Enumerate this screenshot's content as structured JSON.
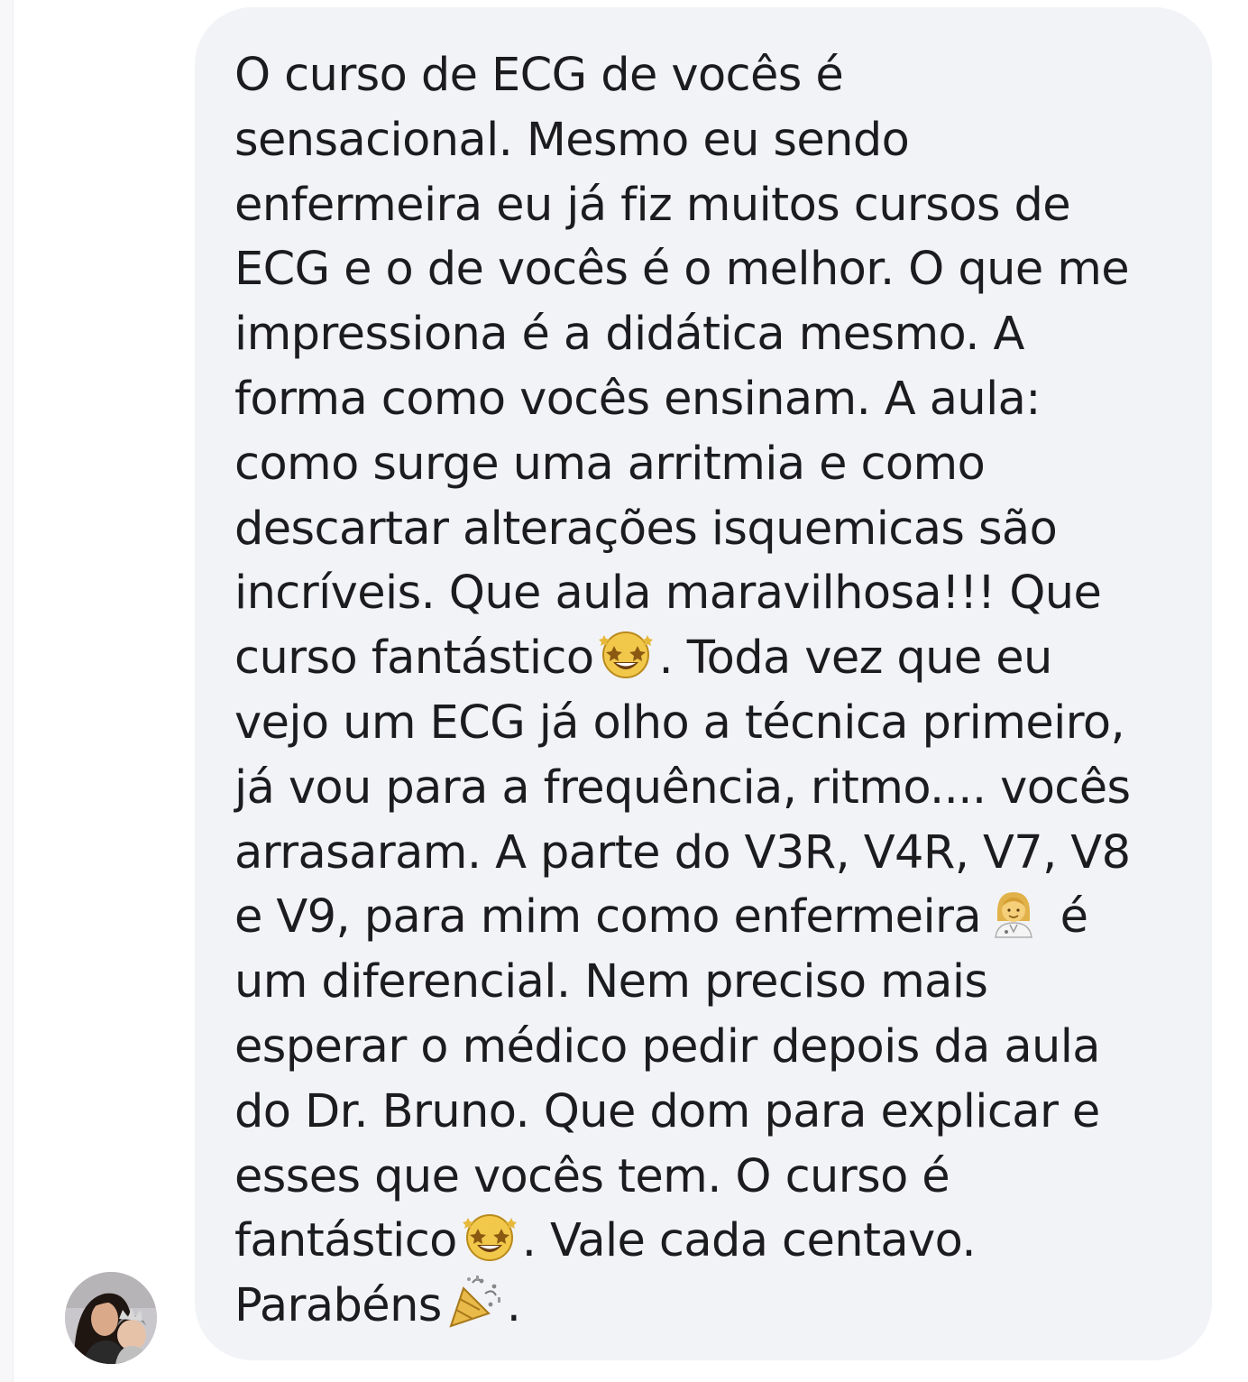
{
  "conversation": {
    "message": {
      "lines": [
        "O curso de ECG de vocês é",
        "sensacional. Mesmo eu sendo",
        "enfermeira eu já fiz muitos cursos de",
        "ECG e o de vocês é o melhor. O que me",
        "impressiona é a didática mesmo. A",
        "forma como vocês ensinam. A aula:",
        "como surge uma arritmia e como",
        "descartar alterações isquemicas são",
        "incríveis. Que aula maravilhosa!!! Que",
        {
          "before": "curso fantástico",
          "after": ". Toda vez que eu"
        },
        "vejo um ECG já olho a técnica primeiro,",
        "já vou para a frequência, ritmo.... vocês",
        "arrasaram. A parte do V3R, V4R, V7, V8",
        {
          "before": "e V9, para mim como enfermeira",
          "after": " é"
        },
        "um diferencial. Nem preciso mais",
        "esperar o médico pedir depois da aula",
        "do Dr. Bruno. Que dom para explicar e",
        "esses que vocês tem. O curso é",
        {
          "before": "fantástico",
          "after": ". Vale cada centavo."
        },
        {
          "before": "Parabéns",
          "after": "."
        }
      ],
      "emojis": {
        "line_10": "star-struck-icon",
        "line_14": "woman-health-worker-icon",
        "line_19": "star-struck-icon",
        "line_20": "party-popper-icon"
      }
    },
    "colors": {
      "bubble_background": "#f2f3f7",
      "text": "#1c1c1e",
      "page_background": "#ffffff"
    }
  }
}
